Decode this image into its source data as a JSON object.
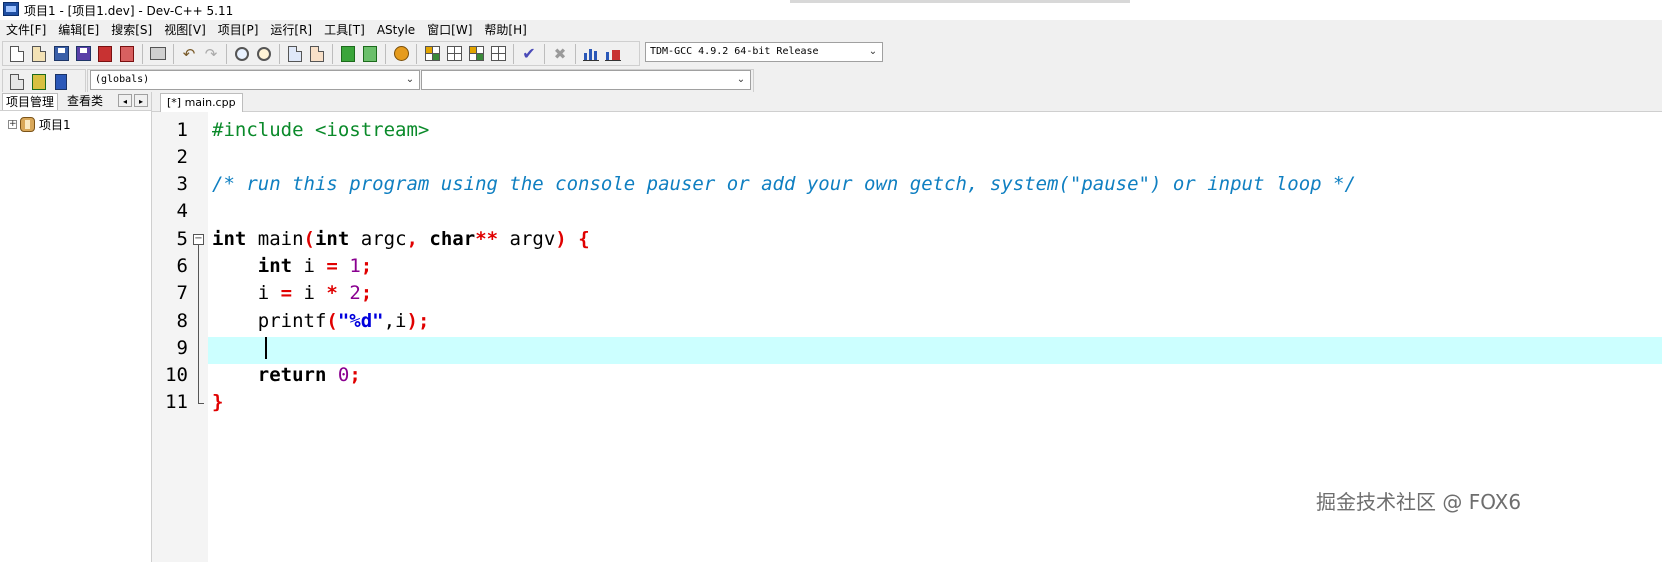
{
  "window": {
    "title": "项目1 - [项目1.dev] - Dev-C++ 5.11"
  },
  "menu": [
    "文件[F]",
    "编辑[E]",
    "搜索[S]",
    "视图[V]",
    "项目[P]",
    "运行[R]",
    "工具[T]",
    "AStyle",
    "窗口[W]",
    "帮助[H]"
  ],
  "toolbar": {
    "compiler": "TDM-GCC 4.9.2 64-bit Release",
    "globals": "(globals)",
    "members": ""
  },
  "left_panel": {
    "tab_project": "项目管理",
    "tab_classes": "查看类",
    "nav_prev": "◂",
    "nav_next": "▸",
    "tree_expander": "+",
    "project_name": "项目1"
  },
  "editor": {
    "tab_label": "[*] main.cpp",
    "line_numbers": [
      "1",
      "2",
      "3",
      "4",
      "5",
      "6",
      "7",
      "8",
      "9",
      "10",
      "11"
    ],
    "fold_symbol": "−"
  },
  "watermark": "掘金技术社区 @ FOX6",
  "colors": {
    "current_line": "#ccffff",
    "preprocessor": "#0a8a2a",
    "comment": "#0f7fc1",
    "operator": "#e00000",
    "number": "#8a0090",
    "string": "#0000dd"
  }
}
